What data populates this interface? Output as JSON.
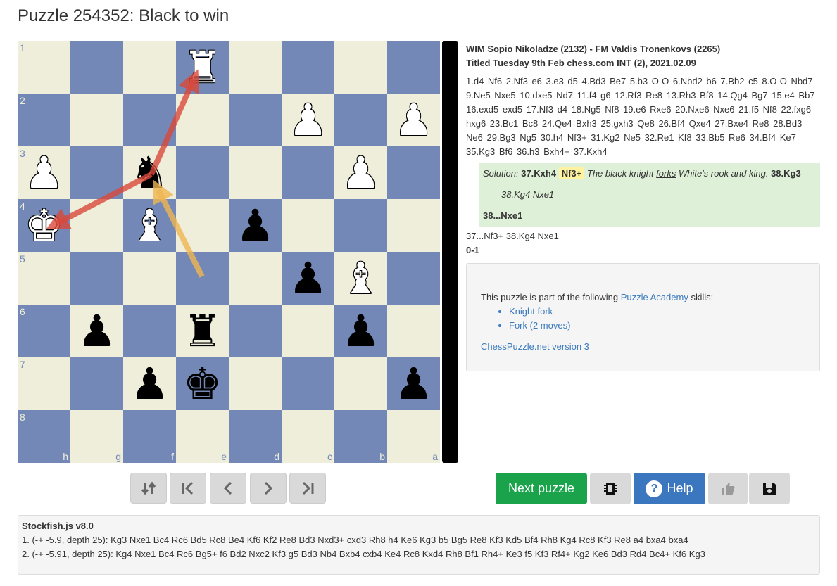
{
  "page": {
    "title": "Puzzle 254352: Black to win"
  },
  "board": {
    "rank_labels": [
      "1",
      "2",
      "3",
      "4",
      "5",
      "6",
      "7",
      "8"
    ],
    "file_labels": [
      "h",
      "g",
      "f",
      "e",
      "d",
      "c",
      "b",
      "a"
    ],
    "pieces": [
      {
        "row": 0,
        "col": 3,
        "glyph": "♜",
        "color": "white",
        "name": "white-rook"
      },
      {
        "row": 1,
        "col": 5,
        "glyph": "♟",
        "color": "white",
        "name": "white-pawn"
      },
      {
        "row": 1,
        "col": 7,
        "glyph": "♟",
        "color": "white",
        "name": "white-pawn"
      },
      {
        "row": 2,
        "col": 0,
        "glyph": "♟",
        "color": "white",
        "name": "white-pawn"
      },
      {
        "row": 2,
        "col": 2,
        "glyph": "♞",
        "color": "black",
        "name": "black-knight"
      },
      {
        "row": 2,
        "col": 6,
        "glyph": "♟",
        "color": "white",
        "name": "white-pawn"
      },
      {
        "row": 3,
        "col": 0,
        "glyph": "♚",
        "color": "white",
        "name": "white-king"
      },
      {
        "row": 3,
        "col": 2,
        "glyph": "♝",
        "color": "white",
        "name": "white-bishop"
      },
      {
        "row": 3,
        "col": 4,
        "glyph": "♟",
        "color": "black",
        "name": "black-pawn"
      },
      {
        "row": 4,
        "col": 5,
        "glyph": "♟",
        "color": "black",
        "name": "black-pawn"
      },
      {
        "row": 4,
        "col": 6,
        "glyph": "♝",
        "color": "white",
        "name": "white-bishop"
      },
      {
        "row": 5,
        "col": 1,
        "glyph": "♟",
        "color": "black",
        "name": "black-pawn"
      },
      {
        "row": 5,
        "col": 3,
        "glyph": "♜",
        "color": "black",
        "name": "black-rook"
      },
      {
        "row": 5,
        "col": 6,
        "glyph": "♟",
        "color": "black",
        "name": "black-pawn"
      },
      {
        "row": 6,
        "col": 2,
        "glyph": "♟",
        "color": "black",
        "name": "black-pawn"
      },
      {
        "row": 6,
        "col": 3,
        "glyph": "♚",
        "color": "black",
        "name": "black-king"
      },
      {
        "row": 6,
        "col": 7,
        "glyph": "♟",
        "color": "black",
        "name": "black-pawn"
      }
    ],
    "arrow_colors": {
      "red": "#d9483b",
      "orange": "#f0b550"
    }
  },
  "game": {
    "players": "WIM Sopio Nikoladze (2132) - FM Valdis Tronenkovs (2265)",
    "event": "Titled Tuesday 9th Feb chess.com INT (2), 2021.02.09",
    "moves": "1.d4 Nf6 2.Nf3 e6 3.e3 d5 4.Bd3 Be7 5.b3 O-O 6.Nbd2 b6 7.Bb2 c5 8.O-O Nbd7 9.Ne5 Nxe5 10.dxe5 Nd7 11.f4 g6 12.Rf3 Re8 13.Rh3 Bf8 14.Qg4 Bg7 15.e4 Bb7 16.exd5 exd5 17.Nf3 d4 18.Ng5 Nf8 19.e6 Rxe6 20.Nxe6 Nxe6 21.f5 Nf8 22.fxg6 hxg6 23.Bc1 Bc8 24.Qe4 Bxh3 25.gxh3 Qe8 26.Bf4 Qxe4 27.Bxe4 Re8 28.Bd3 Ne6 29.Bg3 Ng5 30.h4 Nf3+ 31.Kg2 Ne5 32.Re1 Kf8 33.Bb5 Re6 34.Bf4 Ke7 35.Kg3 Bf6 36.h3 Bxh4+ 37.Kxh4",
    "solution": {
      "label": "Solution:",
      "move1": "37.Kxh4",
      "key_move": "Nf3+",
      "desc_pre": "The black knight ",
      "desc_link": "forks",
      "desc_post": " White's rook and king.",
      "move2": "38.Kg3",
      "variation": "38.Kg4  Nxe1",
      "final": "38...Nxe1"
    },
    "after_moves": "37...Nf3+  38.Kg4  Nxe1",
    "result": "0-1"
  },
  "skills": {
    "intro": "This puzzle is part of the following ",
    "academy_link": "Puzzle Academy",
    "intro_suffix": " skills:",
    "items": [
      "Knight fork",
      "Fork (2 moves)"
    ],
    "version_link": "ChessPuzzle.net version 3"
  },
  "controls": {
    "next_label": "Next puzzle",
    "help_label": "Help",
    "help_icon": "?"
  },
  "engine": {
    "title": "Stockfish.js v8.0",
    "lines": [
      "1. (-+ -5.9, depth 25): Kg3 Nxe1 Bc4 Rc6 Bd5 Rc8 Be4 Kf6 Kf2 Re8 Bd3 Nxd3+ cxd3 Rh8 h4 Ke6 Kg3 b5 Bg5 Re8 Kf3 Kd5 Bf4 Rh8 Kg4 Rc8 Kf3 Re8 a4 bxa4 bxa4",
      "2. (-+ -5.91, depth 25): Kg4 Nxe1 Bc4 Rc6 Bg5+ f6 Bd2 Nxc2 Kf3 g5 Bd3 Nb4 Bxb4 cxb4 Ke4 Rc8 Kxd4 Rh8 Bf1 Rh4+ Ke3 f5 Kf3 Rf4+ Kg2 Ke6 Bd3 Rd4 Bc4+ Kf6 Kg3"
    ]
  }
}
